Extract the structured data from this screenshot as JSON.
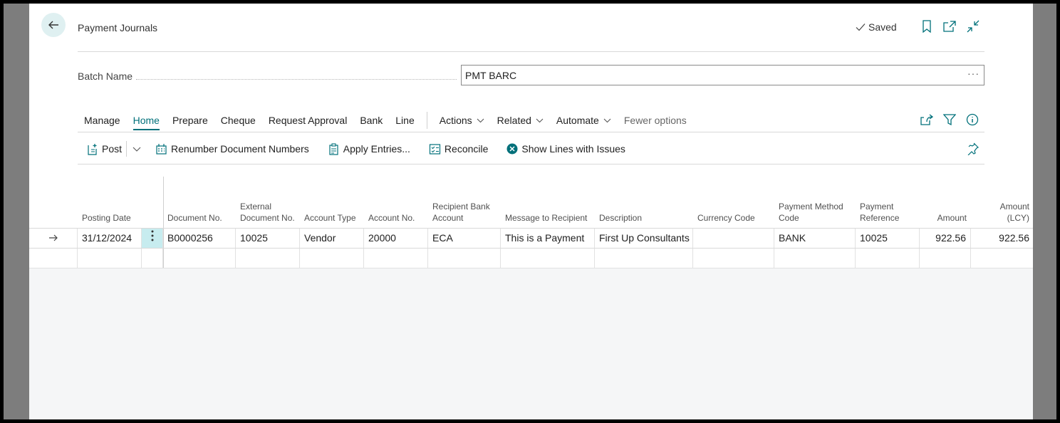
{
  "header": {
    "title": "Payment Journals",
    "saved_label": "Saved"
  },
  "batch": {
    "label": "Batch Name",
    "value": "PMT BARC",
    "more": "···"
  },
  "menu": {
    "items": [
      "Manage",
      "Home",
      "Prepare",
      "Cheque",
      "Request Approval",
      "Bank",
      "Line"
    ],
    "active": "Home",
    "dropdowns": [
      "Actions",
      "Related",
      "Automate"
    ],
    "fewer_options": "Fewer options"
  },
  "actions": {
    "post": "Post",
    "renumber": "Renumber Document Numbers",
    "apply": "Apply Entries...",
    "reconcile": "Reconcile",
    "show_issues": "Show Lines with Issues"
  },
  "table": {
    "columns": [
      "Posting Date",
      "Document No.",
      "External Document No.",
      "Account Type",
      "Account No.",
      "Recipient Bank Account",
      "Message to Recipient",
      "Description",
      "Currency Code",
      "Payment Method Code",
      "Payment Reference",
      "Amount",
      "Amount (LCY)"
    ],
    "rows": [
      {
        "posting_date": "31/12/2024",
        "document_no": "B0000256",
        "external_document_no": "10025",
        "account_type": "Vendor",
        "account_no": "20000",
        "recipient_bank_account": "ECA",
        "message_to_recipient": "This is a Payment",
        "description": "First Up Consultants",
        "currency_code": "",
        "payment_method_code": "BANK",
        "payment_reference": "10025",
        "amount": "922.56",
        "amount_lcy": "922.56"
      }
    ]
  },
  "colors": {
    "accent": "#00707a",
    "back_bg": "#dff0f1"
  }
}
